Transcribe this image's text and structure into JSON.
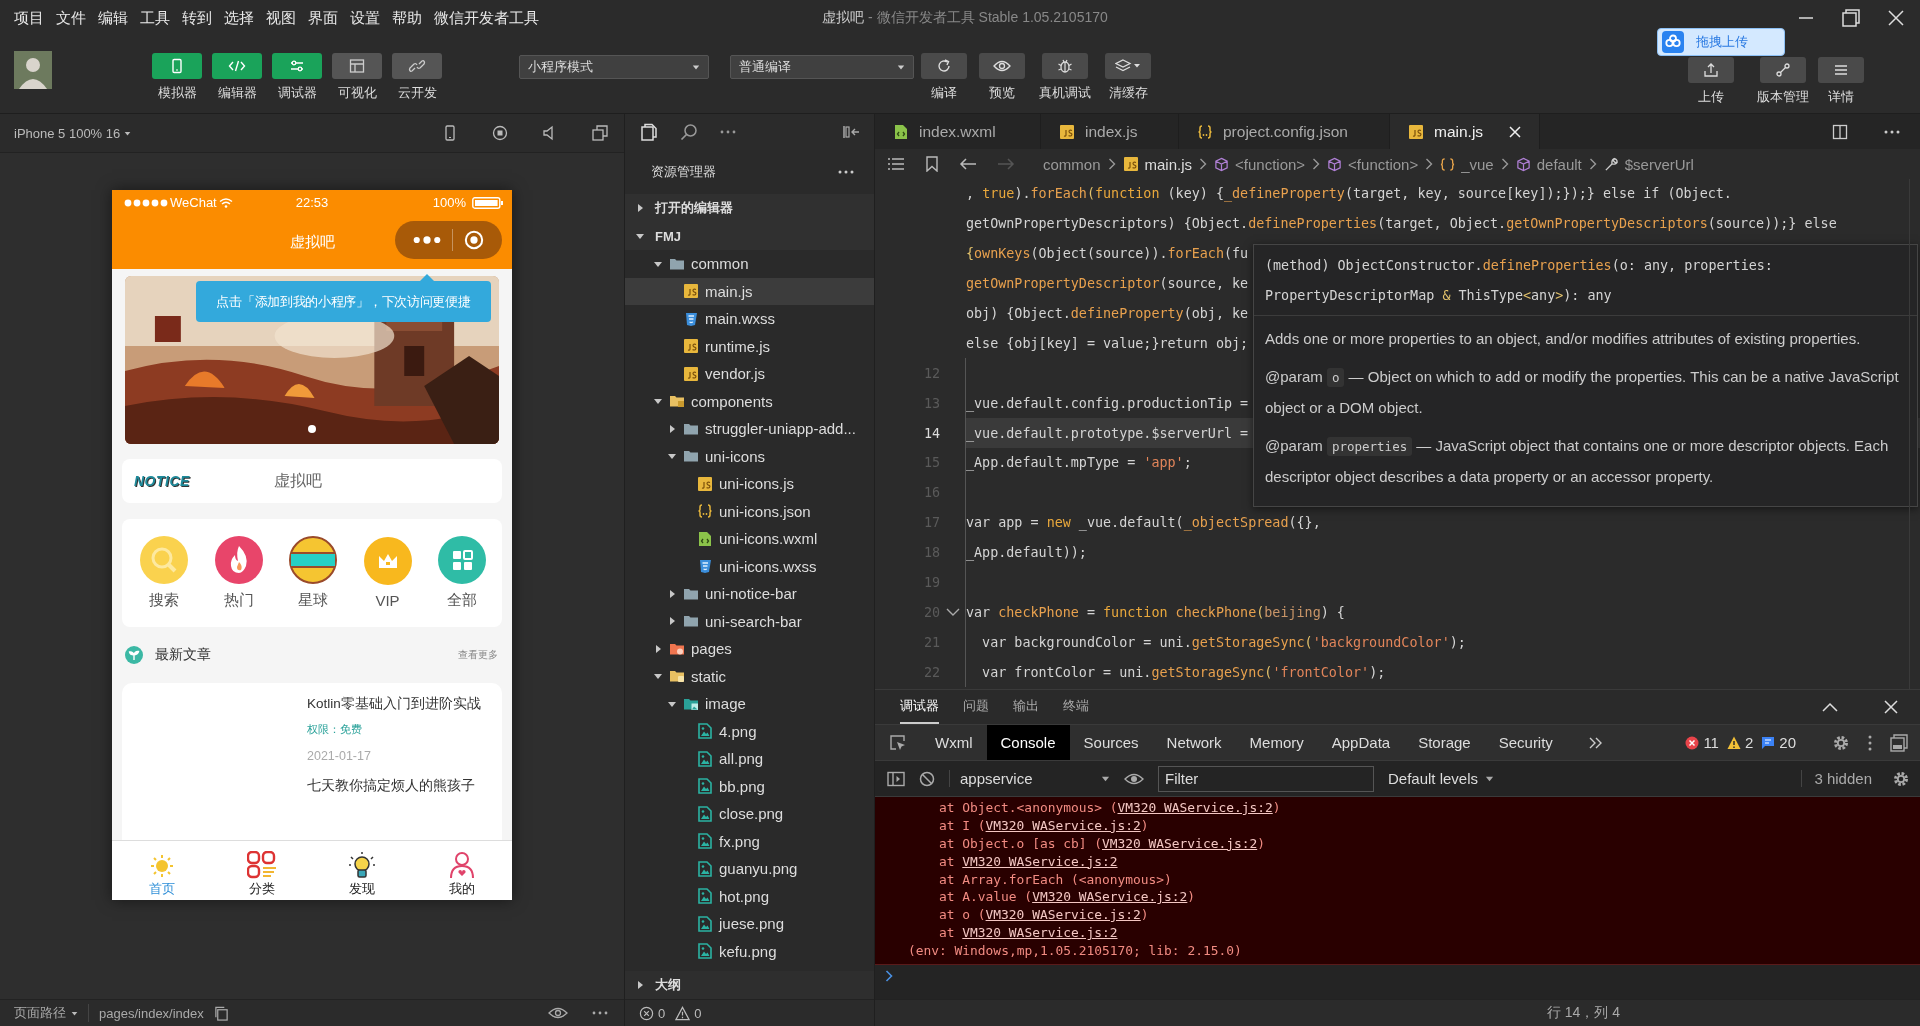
{
  "menu": [
    "项目",
    "文件",
    "编辑",
    "工具",
    "转到",
    "选择",
    "视图",
    "界面",
    "设置",
    "帮助",
    "微信开发者工具"
  ],
  "window": {
    "project": "虚拟吧",
    "title": "- 微信开发者工具 Stable 1.05.2105170"
  },
  "toolbar": {
    "view_buttons": [
      {
        "label": "模拟器",
        "on": true
      },
      {
        "label": "编辑器",
        "on": true
      },
      {
        "label": "调试器",
        "on": true
      },
      {
        "label": "可视化",
        "on": false
      },
      {
        "label": "云开发",
        "on": false
      }
    ],
    "mode": "小程序模式",
    "compile": "普通编译",
    "actions": [
      "编译",
      "预览",
      "真机调试",
      "清缓存"
    ],
    "right_actions": [
      "上传",
      "版本管理",
      "详情"
    ],
    "upload_widget": "拖拽上传"
  },
  "simulator": {
    "device": "iPhone 5 100% 16",
    "phone": {
      "carrier": "WeChat",
      "time": "22:53",
      "battery": "100%",
      "title": "虚拟吧",
      "tip": "点击「添加到我的小程序」，下次访问更便捷",
      "notice_logo": "NOTICE",
      "notice_text": "虚拟吧",
      "categories": [
        "搜索",
        "热门",
        "星球",
        "VIP",
        "全部"
      ],
      "section_title": "最新文章",
      "section_more": "查看更多",
      "article": {
        "title": "Kotlin零基础入门到进阶实战",
        "access": "权限：免费",
        "date": "2021-01-17",
        "next_title": "七天教你搞定烦人的熊孩子"
      },
      "tabbar": [
        {
          "label": "首页",
          "selected": true
        },
        {
          "label": "分类",
          "selected": false
        },
        {
          "label": "发现",
          "selected": false
        },
        {
          "label": "我的",
          "selected": false
        }
      ]
    },
    "page_path_label": "页面路径",
    "page_path": "pages/index/index"
  },
  "explorer": {
    "title": "资源管理器",
    "open_editors": "打开的编辑器",
    "open_editors_expanded": false,
    "project": "FMJ",
    "project_expanded": true,
    "tree": [
      {
        "name": "common",
        "kind": "folder",
        "expanded": true,
        "selected": false,
        "children": [
          {
            "name": "main.js",
            "kind": "js",
            "selected": true
          },
          {
            "name": "main.wxss",
            "kind": "wxss",
            "selected": false
          },
          {
            "name": "runtime.js",
            "kind": "js",
            "selected": false
          },
          {
            "name": "vendor.js",
            "kind": "js",
            "selected": false
          }
        ]
      },
      {
        "name": "components",
        "kind": "folder-components",
        "expanded": true,
        "selected": false,
        "children": [
          {
            "name": "struggler-uniapp-add...",
            "kind": "folder",
            "expanded": false,
            "selected": false
          },
          {
            "name": "uni-icons",
            "kind": "folder",
            "expanded": true,
            "selected": false,
            "children": [
              {
                "name": "uni-icons.js",
                "kind": "js",
                "selected": false
              },
              {
                "name": "uni-icons.json",
                "kind": "json",
                "selected": false
              },
              {
                "name": "uni-icons.wxml",
                "kind": "wxml",
                "selected": false
              },
              {
                "name": "uni-icons.wxss",
                "kind": "wxss",
                "selected": false
              }
            ]
          },
          {
            "name": "uni-notice-bar",
            "kind": "folder",
            "expanded": false,
            "selected": false
          },
          {
            "name": "uni-search-bar",
            "kind": "folder",
            "expanded": false,
            "selected": false
          }
        ]
      },
      {
        "name": "pages",
        "kind": "folder-pages",
        "expanded": false,
        "selected": false
      },
      {
        "name": "static",
        "kind": "folder-static",
        "expanded": true,
        "selected": false,
        "children": [
          {
            "name": "image",
            "kind": "folder-image",
            "expanded": true,
            "selected": false,
            "children": [
              {
                "name": "4.png",
                "kind": "png",
                "selected": false
              },
              {
                "name": "all.png",
                "kind": "png",
                "selected": false
              },
              {
                "name": "bb.png",
                "kind": "png",
                "selected": false
              },
              {
                "name": "close.png",
                "kind": "png",
                "selected": false
              },
              {
                "name": "fx.png",
                "kind": "png",
                "selected": false
              },
              {
                "name": "guanyu.png",
                "kind": "png",
                "selected": false
              },
              {
                "name": "hot.png",
                "kind": "png",
                "selected": false
              },
              {
                "name": "juese.png",
                "kind": "png",
                "selected": false
              },
              {
                "name": "kefu.png",
                "kind": "png",
                "selected": false
              }
            ]
          }
        ]
      }
    ],
    "outline": "大纲",
    "outline_expanded": false,
    "errors": "0",
    "warnings": "0"
  },
  "editor": {
    "tabs": [
      {
        "name": "index.wxml",
        "kind": "wxml",
        "selected": false
      },
      {
        "name": "index.js",
        "kind": "js",
        "selected": false
      },
      {
        "name": "project.config.json",
        "kind": "json",
        "selected": false
      },
      {
        "name": "main.js",
        "kind": "js",
        "selected": true
      }
    ],
    "breadcrumb": [
      {
        "text": "common",
        "kind": "folder"
      },
      {
        "text": "main.js",
        "kind": "js"
      },
      {
        "text": "<function>",
        "kind": "function"
      },
      {
        "text": "<function>",
        "kind": "function"
      },
      {
        "text": "_vue",
        "kind": "module"
      },
      {
        "text": "default",
        "kind": "function"
      },
      {
        "text": "$serverUrl",
        "kind": "property"
      }
    ],
    "lines": [
      {
        "current": false,
        "fold": false,
        "segments": [
          {
            "text": ", ",
            "kind": "plain"
          },
          {
            "text": "true",
            "kind": "keyword"
          },
          {
            "text": ").",
            "kind": "plain"
          },
          {
            "text": "forEach",
            "kind": "call"
          },
          {
            "text": "(",
            "kind": "punct"
          },
          {
            "text": "function",
            "kind": "keyword"
          },
          {
            "text": " (key) {",
            "kind": "plain"
          },
          {
            "text": "_defineProperty",
            "kind": "call"
          },
          {
            "text": "(target, key, source[key]);});} else if (Object.",
            "kind": "plain"
          }
        ]
      },
      {
        "current": false,
        "fold": false,
        "segments": [
          {
            "text": "getOwnPropertyDescriptors) {Object.",
            "kind": "plain"
          },
          {
            "text": "defineProperties",
            "kind": "call"
          },
          {
            "text": "(target, Object.",
            "kind": "plain"
          },
          {
            "text": "getOwnPropertyDescriptors",
            "kind": "call"
          },
          {
            "text": "(source));} else",
            "kind": "plain"
          }
        ]
      },
      {
        "current": false,
        "fold": false,
        "segments": [
          {
            "text": "{",
            "kind": "punct"
          },
          {
            "text": "ownKeys",
            "kind": "call"
          },
          {
            "text": "(Object(source)).",
            "kind": "plain"
          },
          {
            "text": "forEach",
            "kind": "call"
          },
          {
            "text": "(fu",
            "kind": "plain"
          }
        ]
      },
      {
        "current": false,
        "fold": false,
        "segments": [
          {
            "text": "getOwnPropertyDescriptor",
            "kind": "call"
          },
          {
            "text": "(source, ke",
            "kind": "plain"
          }
        ]
      },
      {
        "current": false,
        "fold": false,
        "segments": [
          {
            "text": "obj) {Object.",
            "kind": "plain"
          },
          {
            "text": "defineProperty",
            "kind": "call"
          },
          {
            "text": "(obj, ke",
            "kind": "plain"
          }
        ]
      },
      {
        "current": false,
        "fold": false,
        "segments": [
          {
            "text": "else {obj[key] = value;}return obj;",
            "kind": "plain"
          }
        ]
      },
      {
        "number": "12",
        "current": false,
        "fold": false
      },
      {
        "number": "13",
        "current": false,
        "fold": false,
        "segments": [
          {
            "text": "_vue.default.config.productionTip =",
            "kind": "plain"
          }
        ]
      },
      {
        "number": "14",
        "current": true,
        "fold": false,
        "segments": [
          {
            "text": "_vue.default.prototype.$serverUrl =",
            "kind": "plain"
          }
        ]
      },
      {
        "number": "15",
        "current": false,
        "fold": false,
        "segments": [
          {
            "text": "_App.default.mpType = ",
            "kind": "plain"
          },
          {
            "text": "'app'",
            "kind": "string"
          },
          {
            "text": ";",
            "kind": "plain"
          }
        ]
      },
      {
        "number": "16",
        "current": false,
        "fold": false
      },
      {
        "number": "17",
        "current": false,
        "fold": false,
        "segments": [
          {
            "text": "var app = ",
            "kind": "plain"
          },
          {
            "text": "new",
            "kind": "keyword"
          },
          {
            "text": " _vue.default(",
            "kind": "plain"
          },
          {
            "text": "_objectSpread",
            "kind": "call"
          },
          {
            "text": "({},",
            "kind": "plain"
          }
        ]
      },
      {
        "number": "18",
        "current": false,
        "fold": false,
        "segments": [
          {
            "text": "_App.default));",
            "kind": "plain"
          }
        ]
      },
      {
        "number": "19",
        "current": false,
        "fold": false
      },
      {
        "number": "20",
        "current": false,
        "fold": true,
        "segments": [
          {
            "text": "var ",
            "kind": "plain"
          },
          {
            "text": "checkPhone",
            "kind": "call"
          },
          {
            "text": " = ",
            "kind": "plain"
          },
          {
            "text": "function",
            "kind": "keyword"
          },
          {
            "text": " checkPhone",
            "kind": "call"
          },
          {
            "text": "(",
            "kind": "punct"
          },
          {
            "text": "beijing",
            "kind": "param"
          },
          {
            "text": ") {",
            "kind": "plain"
          }
        ]
      },
      {
        "number": "21",
        "current": false,
        "fold": false,
        "segments": [
          {
            "text": "  var backgroundColor = uni.",
            "kind": "plain"
          },
          {
            "text": "getStorageSync",
            "kind": "call"
          },
          {
            "text": "(",
            "kind": "punct"
          },
          {
            "text": "'backgroundColor'",
            "kind": "string"
          },
          {
            "text": ");",
            "kind": "plain"
          }
        ]
      },
      {
        "number": "22",
        "current": false,
        "fold": false,
        "segments": [
          {
            "text": "  var frontColor = uni.",
            "kind": "plain"
          },
          {
            "text": "getStorageSync",
            "kind": "call"
          },
          {
            "text": "(",
            "kind": "punct"
          },
          {
            "text": "'frontColor'",
            "kind": "string"
          },
          {
            "text": ");",
            "kind": "plain"
          }
        ]
      }
    ],
    "hover": {
      "signature": [
        [
          {
            "text": "(method) ObjectConstructor.",
            "kind": "plain"
          },
          {
            "text": "defineProperties",
            "kind": "call"
          },
          {
            "text": "(o: any, properties:",
            "kind": "plain"
          }
        ],
        [
          {
            "text": "PropertyDescriptorMap ",
            "kind": "plain"
          },
          {
            "text": "&",
            "kind": "punct"
          },
          {
            "text": " ThisType",
            "kind": "plain"
          },
          {
            "text": "<",
            "kind": "punct"
          },
          {
            "text": "any",
            "kind": "plain"
          },
          {
            "text": ">",
            "kind": "punct"
          },
          {
            "text": "): any",
            "kind": "plain"
          }
        ]
      ],
      "description": "Adds one or more properties to an object, and/or modifies attributes of existing properties.",
      "params": [
        {
          "tag": "@param",
          "name": "o",
          "text": "— Object on which to add or modify the properties. This can be a native JavaScript object or a DOM object."
        },
        {
          "tag": "@param",
          "name": "properties",
          "text": "— JavaScript object that contains one or more descriptor objects. Each descriptor object describes a data property or an accessor property."
        }
      ]
    },
    "status": "行 14，列 4"
  },
  "devtools": {
    "panel_tabs": [
      {
        "label": "调试器",
        "selected": true
      },
      {
        "label": "问题",
        "selected": false
      },
      {
        "label": "输出",
        "selected": false
      },
      {
        "label": "终端",
        "selected": false
      }
    ],
    "tabs": [
      {
        "label": "Wxml",
        "selected": false
      },
      {
        "label": "Console",
        "selected": true
      },
      {
        "label": "Sources",
        "selected": false
      },
      {
        "label": "Network",
        "selected": false
      },
      {
        "label": "Memory",
        "selected": false
      },
      {
        "label": "AppData",
        "selected": false
      },
      {
        "label": "Storage",
        "selected": false
      },
      {
        "label": "Security",
        "selected": false
      }
    ],
    "errors": "11",
    "warnings": "2",
    "messages": "20",
    "context": "appservice",
    "filter_placeholder": "Filter",
    "levels": "Default levels",
    "hidden": "3 hidden",
    "console": [
      {
        "kind": "frame",
        "text": "at Object.<anonymous> (",
        "link": "VM320 WAService.js:2",
        "after": ")"
      },
      {
        "kind": "frame",
        "text": "at I (",
        "link": "VM320 WAService.js:2",
        "after": ")"
      },
      {
        "kind": "frame",
        "text": "at Object.o [as cb] (",
        "link": "VM320 WAService.js:2",
        "after": ")"
      },
      {
        "kind": "frame",
        "text": "at ",
        "link": "VM320 WAService.js:2"
      },
      {
        "kind": "frame",
        "text": "at Array.forEach (<anonymous>)"
      },
      {
        "kind": "frame",
        "text": "at A.value (",
        "link": "VM320 WAService.js:2",
        "after": ")"
      },
      {
        "kind": "frame",
        "text": "at o (",
        "link": "VM320 WAService.js:2",
        "after": ")"
      },
      {
        "kind": "frame",
        "text": "at ",
        "link": "VM320 WAService.js:2"
      },
      {
        "kind": "env",
        "text": "(env: Windows,mp,1.05.2105170; lib: 2.15.0)"
      }
    ]
  }
}
